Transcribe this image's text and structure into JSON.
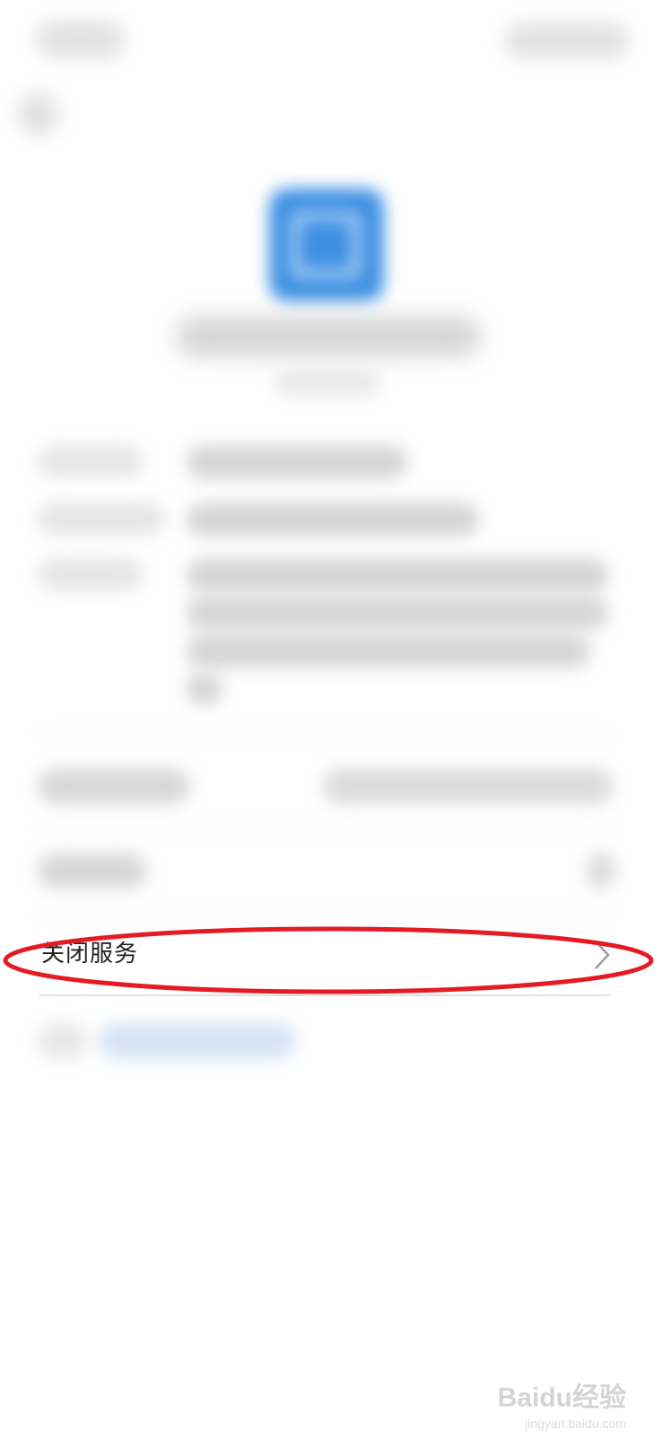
{
  "status_bar": {
    "time": "",
    "indicators": ""
  },
  "header": {
    "back_icon": "chevron-left-icon"
  },
  "app": {
    "icon": "app-icon",
    "icon_color": "#3d8fe3"
  },
  "rows": {
    "close_service_label": "关闭服务",
    "close_service_icon": "chevron-right-icon"
  },
  "annotation": {
    "color": "#e31b23"
  },
  "watermark": {
    "brand": "Baidu经验",
    "url": "jingyan.baidu.com"
  }
}
